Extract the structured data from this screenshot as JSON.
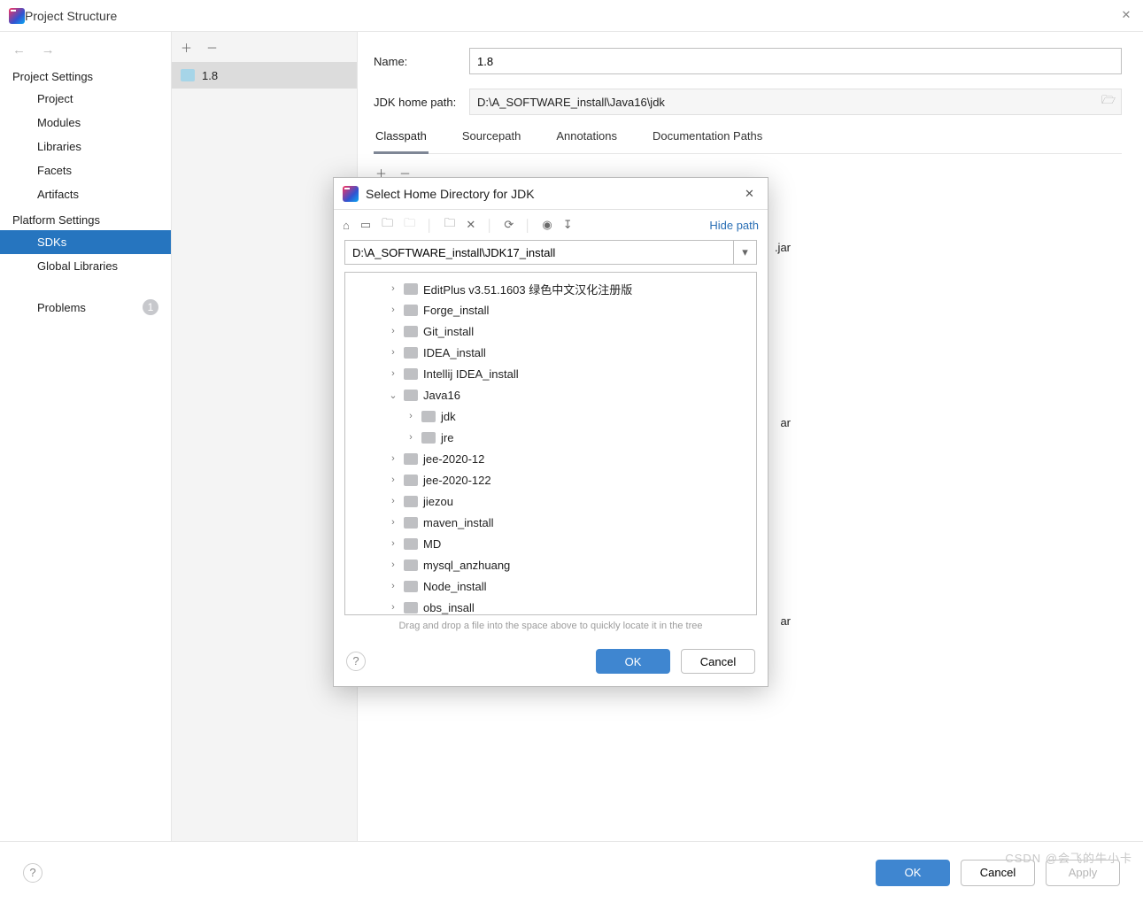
{
  "titlebar": {
    "title": "Project Structure"
  },
  "leftnav": {
    "section_project": "Project Settings",
    "items_project": [
      "Project",
      "Modules",
      "Libraries",
      "Facets",
      "Artifacts"
    ],
    "section_platform": "Platform Settings",
    "items_platform": [
      "SDKs",
      "Global Libraries"
    ],
    "problems_label": "Problems",
    "problems_count": "1"
  },
  "midcol": {
    "sdk_name": "1.8"
  },
  "detail": {
    "name_label": "Name:",
    "name_value": "1.8",
    "jdk_label": "JDK home path:",
    "jdk_value": "D:\\A_SOFTWARE_install\\Java16\\jdk",
    "tabs": [
      "Classpath",
      "Sourcepath",
      "Annotations",
      "Documentation Paths"
    ],
    "stray_jar_1": ".jar",
    "stray_jar_2": "ar",
    "stray_jar_3": "ar"
  },
  "dialog": {
    "title": "Select Home Directory for JDK",
    "hide_path": "Hide path",
    "path_value": "D:\\A_SOFTWARE_install\\JDK17_install",
    "tree": [
      {
        "indent": 44,
        "chev": "right",
        "label": "EditPlus v3.51.1603 绿色中文汉化注册版"
      },
      {
        "indent": 44,
        "chev": "right",
        "label": "Forge_install"
      },
      {
        "indent": 44,
        "chev": "right",
        "label": "Git_install"
      },
      {
        "indent": 44,
        "chev": "right",
        "label": "IDEA_install"
      },
      {
        "indent": 44,
        "chev": "right",
        "label": "Intellij IDEA_install"
      },
      {
        "indent": 44,
        "chev": "down",
        "label": "Java16"
      },
      {
        "indent": 64,
        "chev": "right",
        "label": "jdk"
      },
      {
        "indent": 64,
        "chev": "right",
        "label": "jre"
      },
      {
        "indent": 44,
        "chev": "right",
        "label": "jee-2020-12"
      },
      {
        "indent": 44,
        "chev": "right",
        "label": "jee-2020-122"
      },
      {
        "indent": 44,
        "chev": "right",
        "label": "jiezou"
      },
      {
        "indent": 44,
        "chev": "right",
        "label": "maven_install"
      },
      {
        "indent": 44,
        "chev": "right",
        "label": "MD"
      },
      {
        "indent": 44,
        "chev": "right",
        "label": "mysql_anzhuang"
      },
      {
        "indent": 44,
        "chev": "right",
        "label": "Node_install"
      },
      {
        "indent": 44,
        "chev": "right",
        "label": "obs_insall"
      }
    ],
    "hint": "Drag and drop a file into the space above to quickly locate it in the tree",
    "ok": "OK",
    "cancel": "Cancel"
  },
  "footer": {
    "ok": "OK",
    "cancel": "Cancel",
    "apply": "Apply"
  },
  "watermark": "CSDN @会飞的牛小卡"
}
